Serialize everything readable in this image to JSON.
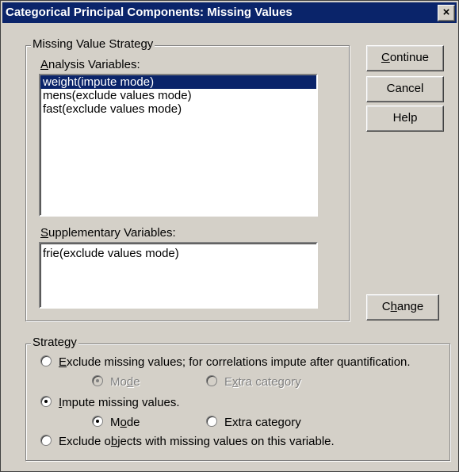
{
  "dialog": {
    "title": "Categorical Principal Components: Missing Values",
    "close_label": "×"
  },
  "missing_value_strategy": {
    "legend": "Missing Value Strategy",
    "analysis_label": {
      "ul": "A",
      "rest": "nalysis Variables:"
    },
    "analysis_items": [
      "weight(impute mode)",
      "mens(exclude values mode)",
      "fast(exclude values mode)"
    ],
    "selected_index": 0,
    "supplementary_label": {
      "ul": "S",
      "rest": "upplementary Variables:"
    },
    "supplementary_items": [
      "frie(exclude values mode)"
    ]
  },
  "buttons": {
    "continue": {
      "ul": "C",
      "rest": "ontinue"
    },
    "cancel": "Cancel",
    "help": "Help",
    "change": {
      "pre": "C",
      "ul": "h",
      "rest": "ange"
    }
  },
  "strategy": {
    "legend": "Strategy",
    "exclude_missing": {
      "ul": "E",
      "rest": "xclude missing values; for correlations impute after quantification.",
      "checked": false
    },
    "exclude_sub_mode": {
      "pre": "Mo",
      "ul": "d",
      "rest": "e",
      "checked": true,
      "enabled": false
    },
    "exclude_sub_extra": {
      "pre": "E",
      "ul": "x",
      "rest": "tra category",
      "checked": false,
      "enabled": false
    },
    "impute_missing": {
      "ul": "I",
      "rest": "mpute missing values.",
      "checked": true
    },
    "impute_sub_mode": {
      "pre": "M",
      "ul": "o",
      "rest": "de",
      "checked": true,
      "enabled": true
    },
    "impute_sub_extra": {
      "label": "Extra category",
      "checked": false,
      "enabled": true
    },
    "exclude_objects": {
      "pre": "Exclude o",
      "ul": "b",
      "rest": "jects with missing values on this variable.",
      "checked": false
    }
  }
}
